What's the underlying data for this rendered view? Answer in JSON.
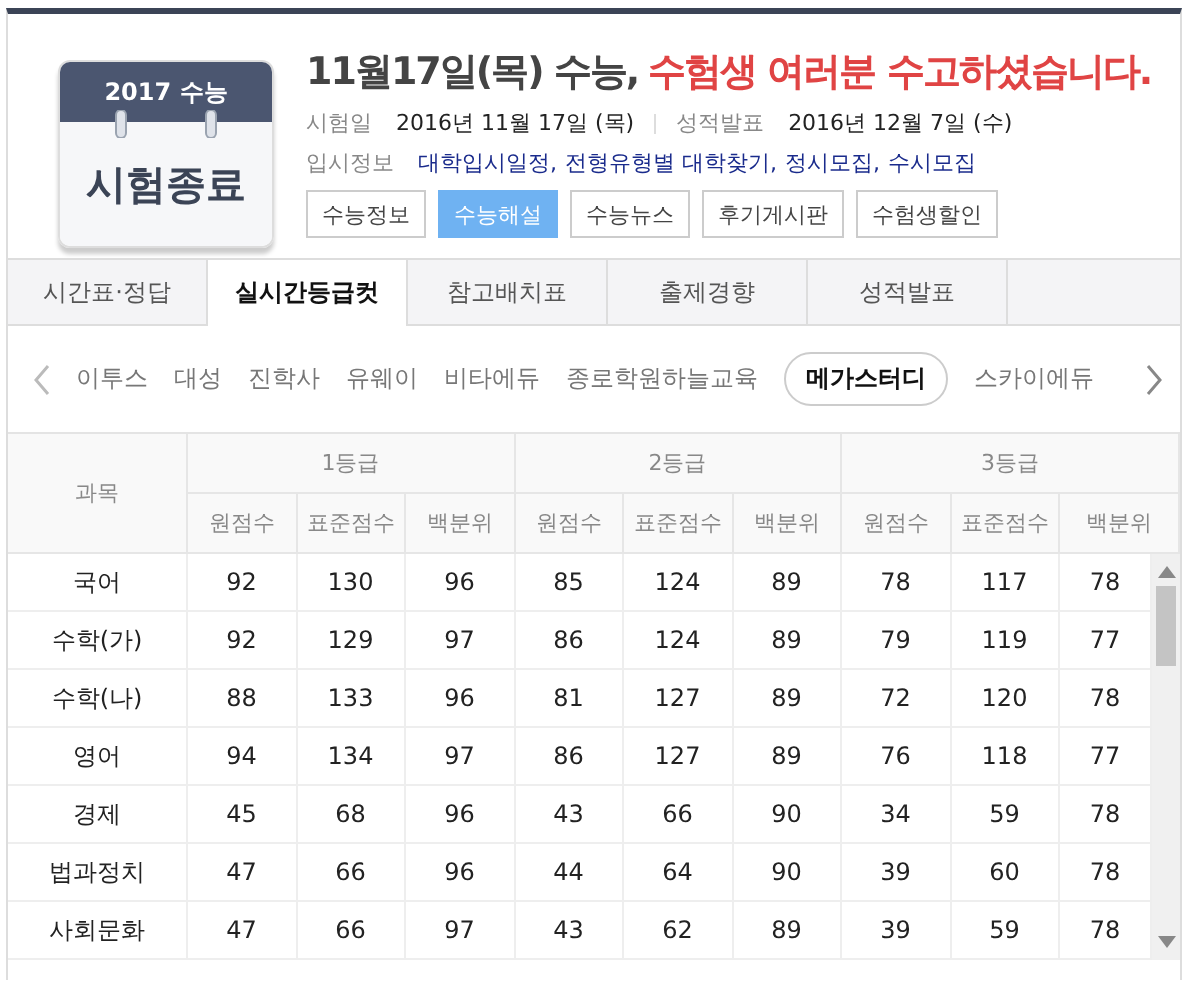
{
  "badge": {
    "year": "2017 수능",
    "status": "시험종료"
  },
  "headline": {
    "main": "11월17일(목) 수능,",
    "highlight": "수험생 여러분 수고하셨습니다."
  },
  "dates": [
    {
      "label": "시험일",
      "value": "2016년 11월 17일 (목)"
    },
    {
      "label": "성적발표",
      "value": "2016년 12월 7일 (수)"
    }
  ],
  "admission": {
    "label": "입시정보",
    "links": [
      "대학입시일정,",
      "전형유형별 대학찾기,",
      "정시모집,",
      "수시모집"
    ]
  },
  "buttons": [
    {
      "label": "수능정보",
      "selected": false
    },
    {
      "label": "수능해설",
      "selected": true
    },
    {
      "label": "수능뉴스",
      "selected": false
    },
    {
      "label": "후기게시판",
      "selected": false
    },
    {
      "label": "수험생할인",
      "selected": false
    }
  ],
  "tabs": [
    {
      "label": "시간표·정답",
      "selected": false
    },
    {
      "label": "실시간등급컷",
      "selected": true
    },
    {
      "label": "참고배치표",
      "selected": false
    },
    {
      "label": "출제경향",
      "selected": false
    },
    {
      "label": "성적발표",
      "selected": false
    }
  ],
  "academies": [
    {
      "label": "이투스",
      "selected": false
    },
    {
      "label": "대성",
      "selected": false
    },
    {
      "label": "진학사",
      "selected": false
    },
    {
      "label": "유웨이",
      "selected": false
    },
    {
      "label": "비타에듀",
      "selected": false
    },
    {
      "label": "종로학원하늘교육",
      "selected": false
    },
    {
      "label": "메가스터디",
      "selected": true
    },
    {
      "label": "스카이에듀",
      "selected": false
    }
  ],
  "table": {
    "subject_header": "과목",
    "grades": [
      "1등급",
      "2등급",
      "3등급"
    ],
    "sub_headers": [
      "원점수",
      "표준점수",
      "백분위",
      "원점수",
      "표준점수",
      "백분위",
      "원점수",
      "표준점수",
      "백분위"
    ],
    "rows": [
      {
        "subject": "국어",
        "values": [
          "92",
          "130",
          "96",
          "85",
          "124",
          "89",
          "78",
          "117",
          "78"
        ]
      },
      {
        "subject": "수학(가)",
        "values": [
          "92",
          "129",
          "97",
          "86",
          "124",
          "89",
          "79",
          "119",
          "77"
        ]
      },
      {
        "subject": "수학(나)",
        "values": [
          "88",
          "133",
          "96",
          "81",
          "127",
          "89",
          "72",
          "120",
          "78"
        ]
      },
      {
        "subject": "영어",
        "values": [
          "94",
          "134",
          "97",
          "86",
          "127",
          "89",
          "76",
          "118",
          "77"
        ]
      },
      {
        "subject": "경제",
        "values": [
          "45",
          "68",
          "96",
          "43",
          "66",
          "90",
          "34",
          "59",
          "78"
        ]
      },
      {
        "subject": "법과정치",
        "values": [
          "47",
          "66",
          "96",
          "44",
          "64",
          "90",
          "39",
          "60",
          "78"
        ]
      },
      {
        "subject": "사회문화",
        "values": [
          "47",
          "66",
          "97",
          "43",
          "62",
          "89",
          "39",
          "59",
          "78"
        ]
      }
    ]
  }
}
